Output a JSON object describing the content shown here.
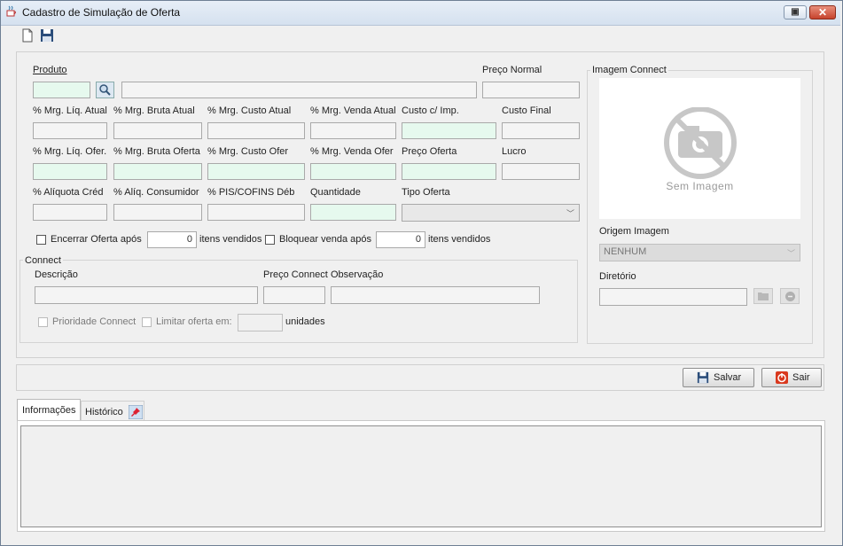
{
  "window": {
    "title": "Cadastro de Simulação de Oferta"
  },
  "toolbar": {
    "new_icon": "new-document-icon",
    "save_icon": "floppy-disk-icon"
  },
  "produto": {
    "label": "Produto",
    "code": "",
    "description": "",
    "preco_normal_label": "Preço Normal",
    "preco_normal": ""
  },
  "row1": {
    "mrg_liq_atual": "% Mrg. Líq. Atual",
    "mrg_bruta_atual": "% Mrg. Bruta Atual",
    "mrg_custo_atual": "% Mrg. Custo Atual",
    "mrg_venda_atual": "% Mrg. Venda Atual",
    "custo_imp": "Custo c/ Imp.",
    "custo_final": "Custo Final"
  },
  "row2": {
    "mrg_liq_ofer": "% Mrg. Líq. Ofer.",
    "mrg_bruta_oferta": "% Mrg. Bruta Oferta",
    "mrg_custo_ofer": "% Mrg. Custo Ofer",
    "mrg_venda_ofer": "% Mrg. Venda Ofer",
    "preco_oferta": "Preço Oferta",
    "lucro": "Lucro"
  },
  "row3": {
    "aliquota_cred": "% Alíquota Créd",
    "aliq_consumidor": "% Alíq. Consumidor",
    "pis_cofins": "% PIS/COFINS Déb",
    "quantidade": "Quantidade",
    "tipo_oferta": "Tipo Oferta",
    "tipo_oferta_value": ""
  },
  "encerrar": {
    "label": "Encerrar Oferta após",
    "value": "0",
    "suffix": "itens vendidos"
  },
  "bloquear": {
    "label": "Bloquear venda após",
    "value": "0",
    "suffix": "itens vendidos"
  },
  "connect": {
    "title": "Connect",
    "descricao_label": "Descrição",
    "preco_label": "Preço Connect",
    "observacao_label": "Observação",
    "prioridade_label": "Prioridade Connect",
    "limitar_label": "Limitar oferta em:",
    "limitar_value": "",
    "unidades_label": "unidades"
  },
  "imagem": {
    "title": "Imagem Connect",
    "placeholder": "Sem Imagem",
    "origem_label": "Origem Imagem",
    "origem_value": "NENHUM",
    "diretorio_label": "Diretório"
  },
  "actions": {
    "salvar": "Salvar",
    "sair": "Sair"
  },
  "tabs": [
    {
      "label": "Informações"
    },
    {
      "label": "Histórico"
    }
  ]
}
